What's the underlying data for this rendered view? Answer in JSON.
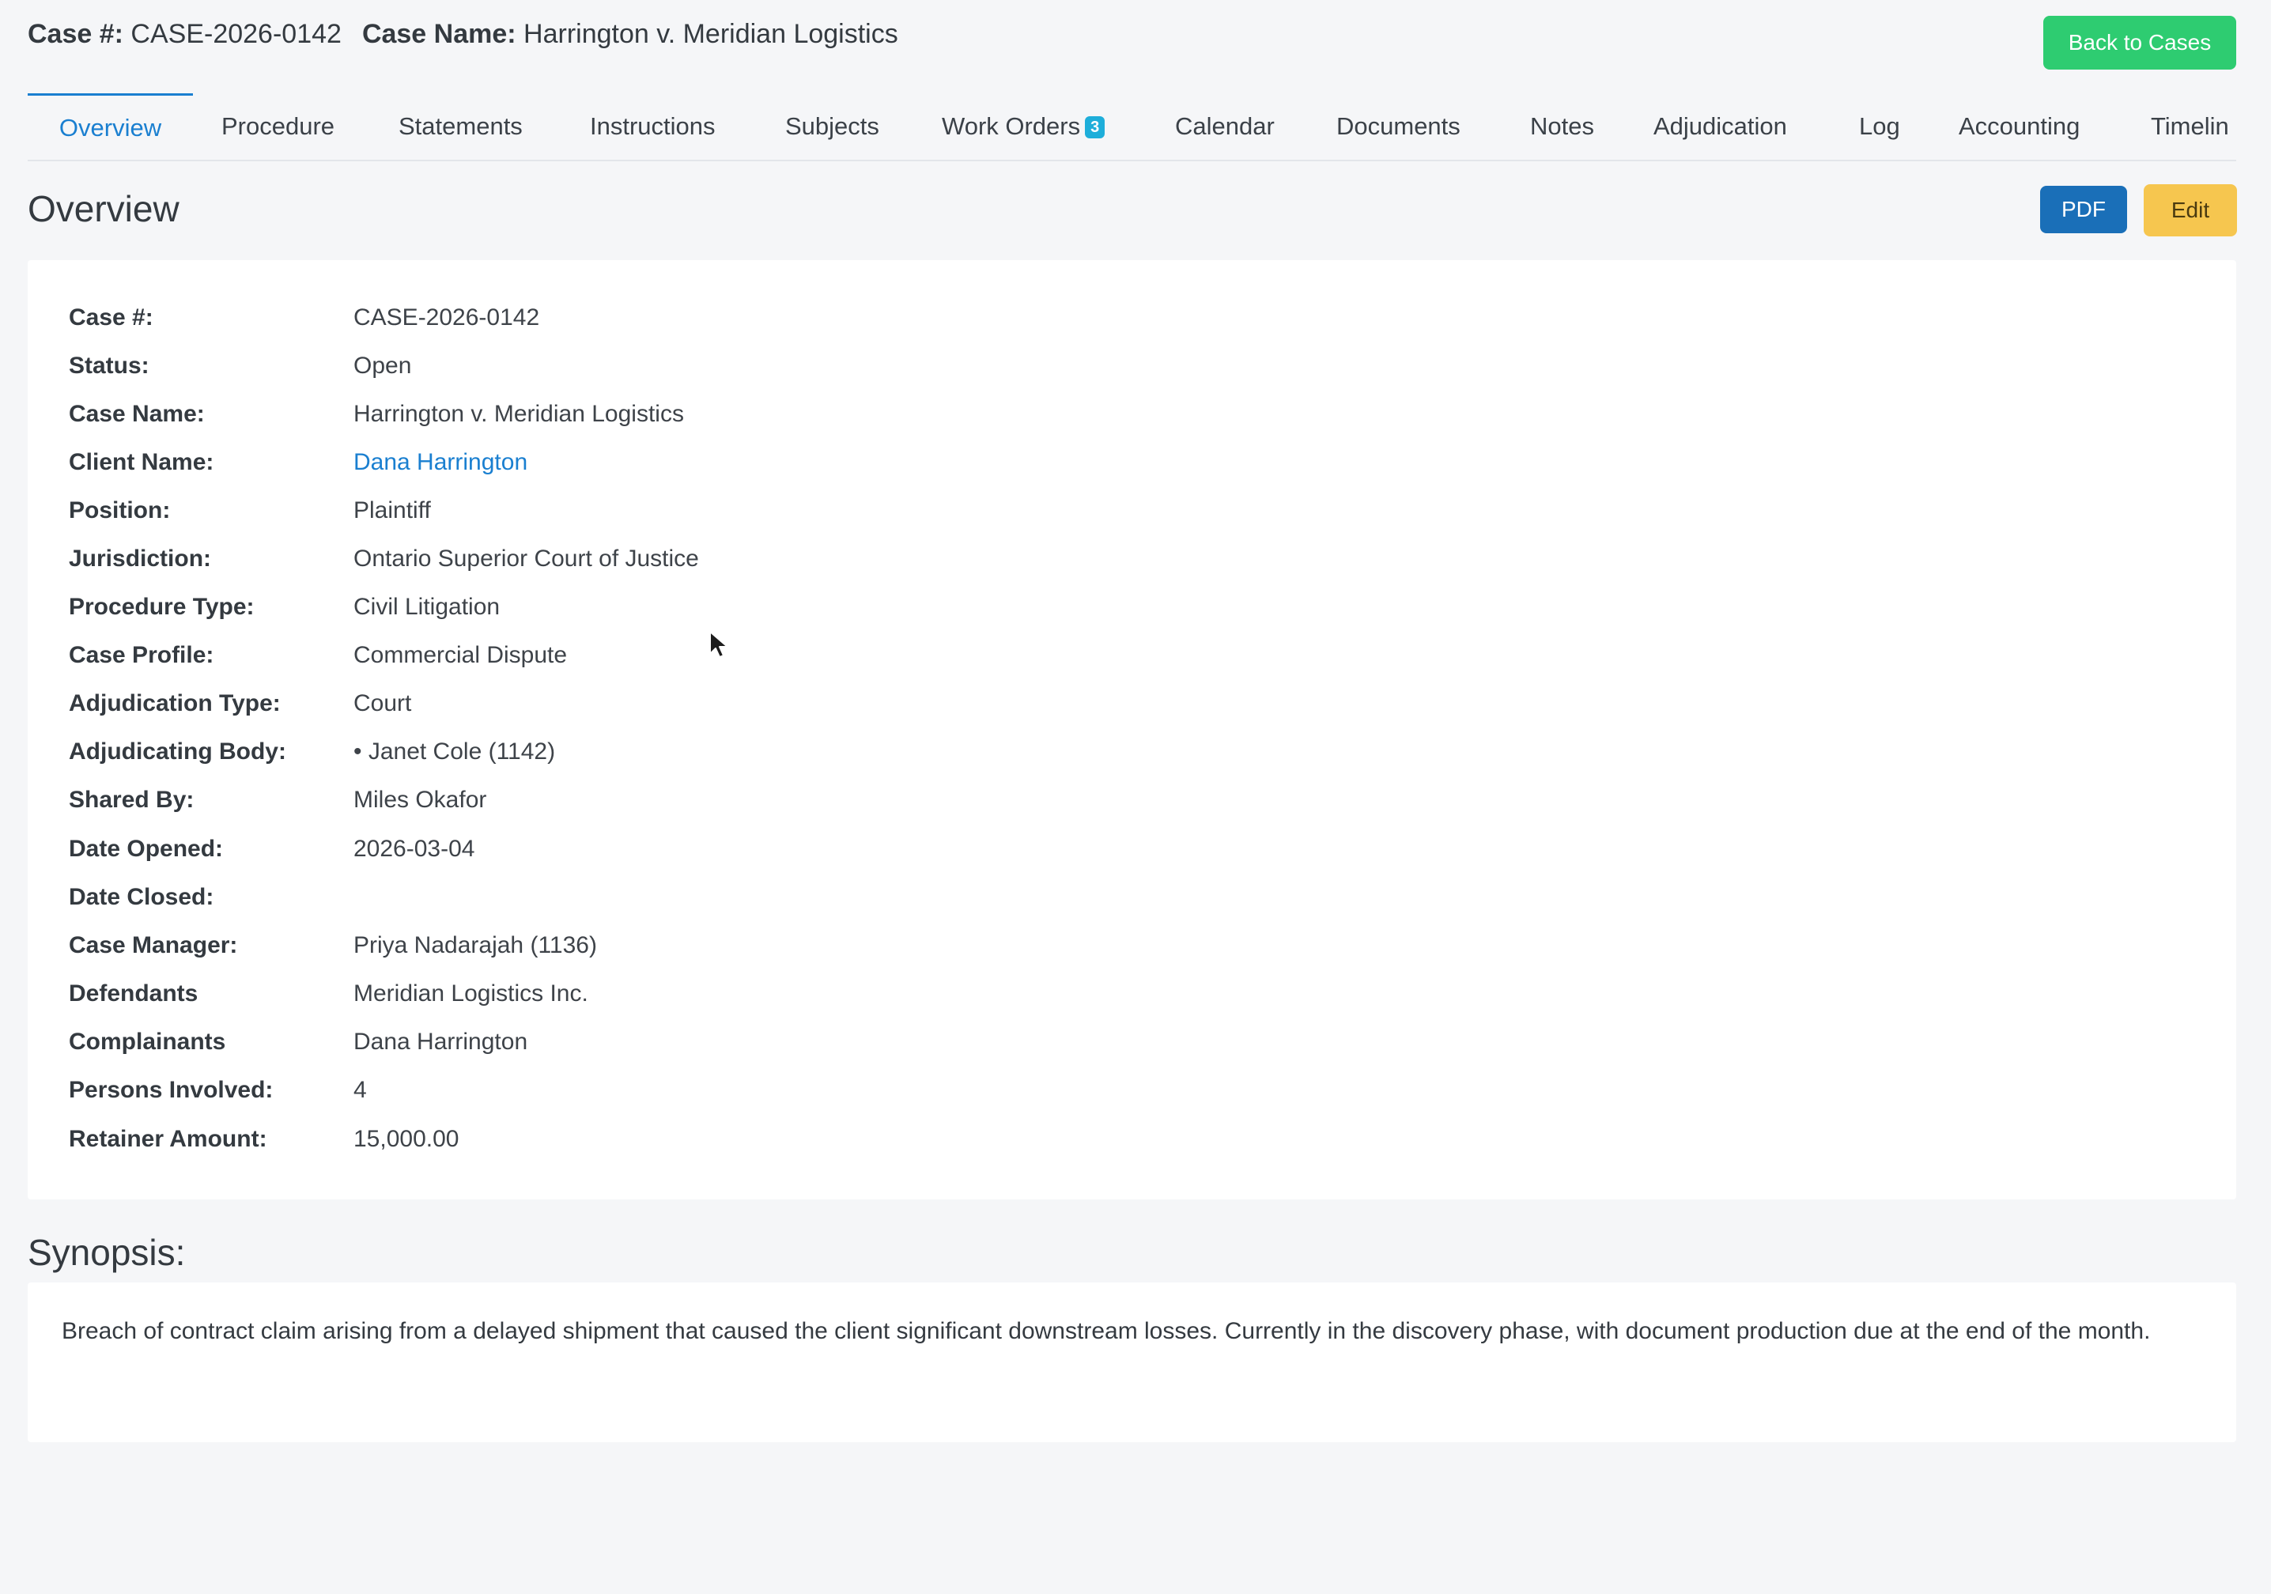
{
  "header": {
    "case_no_label": "Case #:",
    "case_no": "CASE-2026-0142",
    "case_name_label": "Case Name:",
    "case_name": "Harrington v. Meridian Logistics",
    "back_button": "Back to Cases"
  },
  "tabs": [
    {
      "label": "Overview",
      "active": true
    },
    {
      "label": "Procedure"
    },
    {
      "label": "Statements"
    },
    {
      "label": "Instructions"
    },
    {
      "label": "Subjects"
    },
    {
      "label": "Work Orders",
      "badge": "3"
    },
    {
      "label": "Calendar"
    },
    {
      "label": "Documents"
    },
    {
      "label": "Notes"
    },
    {
      "label": "Adjudication"
    },
    {
      "label": "Log"
    },
    {
      "label": "Accounting"
    },
    {
      "label": "Timelin"
    }
  ],
  "overview": {
    "title": "Overview",
    "pdf_button": "PDF",
    "edit_button": "Edit",
    "fields": [
      {
        "label": "Case #:",
        "value": "CASE-2026-0142"
      },
      {
        "label": "Status:",
        "value": "Open"
      },
      {
        "label": "Case Name:",
        "value": "Harrington v. Meridian Logistics"
      },
      {
        "label": "Client Name:",
        "value": "Dana Harrington",
        "link": true
      },
      {
        "label": "Position:",
        "value": "Plaintiff"
      },
      {
        "label": "Jurisdiction:",
        "value": "Ontario Superior Court of Justice"
      },
      {
        "label": "Procedure Type:",
        "value": "Civil Litigation"
      },
      {
        "label": "Case Profile:",
        "value": "Commercial Dispute"
      },
      {
        "label": "Adjudication Type:",
        "value": "Court"
      },
      {
        "label": "Adjudicating Body:",
        "value": "• Janet Cole (1142)"
      },
      {
        "label": "Shared By:",
        "value": "Miles Okafor"
      },
      {
        "label": "Date Opened:",
        "value": "2026-03-04"
      },
      {
        "label": "Date Closed:",
        "value": ""
      },
      {
        "label": "Case Manager:",
        "value": "Priya Nadarajah (1136)"
      },
      {
        "label": "Defendants",
        "value": "Meridian Logistics Inc."
      },
      {
        "label": "Complainants",
        "value": "Dana Harrington"
      },
      {
        "label": "Persons Involved:",
        "value": "4"
      },
      {
        "label": "Retainer Amount:",
        "value": "15,000.00"
      }
    ]
  },
  "synopsis": {
    "title": "Synopsis:",
    "text": "Breach of contract claim arising from a delayed shipment that caused the client significant downstream losses. Currently in the discovery phase, with document production due at the end of the month."
  },
  "colors": {
    "accent": "#1a7fd0",
    "success": "#2ecc71",
    "pdf": "#1a6fb8",
    "edit": "#f6c64f",
    "badge": "#1eaeda"
  },
  "icons": [
    "mouse-pointer-icon"
  ]
}
